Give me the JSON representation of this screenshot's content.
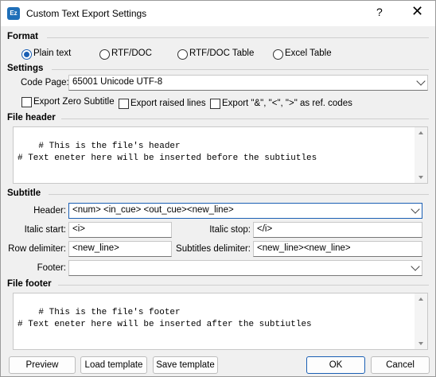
{
  "window": {
    "title": "Custom Text Export Settings",
    "help": "?",
    "close": "✕",
    "app_icon": "Ez"
  },
  "format": {
    "heading": "Format",
    "options": [
      "Plain text",
      "RTF/DOC",
      "RTF/DOC Table",
      "Excel Table"
    ],
    "selected": "Plain text"
  },
  "settings": {
    "heading": "Settings",
    "code_page_label": "Code Page:",
    "code_page_value": "65001 Unicode UTF-8",
    "export_zero_subtitle": "Export Zero Subtitle",
    "export_raised_lines": "Export raised lines",
    "export_ref_codes": "Export \"&\", \"<\", \">\" as ref. codes"
  },
  "file_header": {
    "heading": "File header",
    "text": "# This is the file's header\n# Text eneter here will be inserted before the subtiutles"
  },
  "subtitle": {
    "heading": "Subtitle",
    "header_label": "Header:",
    "header_value": "<num> <in_cue> <out_cue><new_line>",
    "italic_start_label": "Italic start:",
    "italic_start_value": "<i>",
    "italic_stop_label": "Italic stop:",
    "italic_stop_value": "</i>",
    "row_delimiter_label": "Row delimiter:",
    "row_delimiter_value": "<new_line>",
    "subtitles_delimiter_label": "Subtitles delimiter:",
    "subtitles_delimiter_value": "<new_line><new_line>",
    "footer_label": "Footer:",
    "footer_value": ""
  },
  "file_footer": {
    "heading": "File footer",
    "text": "# This is the file's footer\n# Text eneter here will be inserted after the subtiutles"
  },
  "buttons": {
    "preview": "Preview",
    "load_template": "Load template",
    "save_template": "Save template",
    "ok": "OK",
    "cancel": "Cancel"
  },
  "colors": {
    "accent": "#1a5fb4",
    "background": "#f0f0f0"
  }
}
